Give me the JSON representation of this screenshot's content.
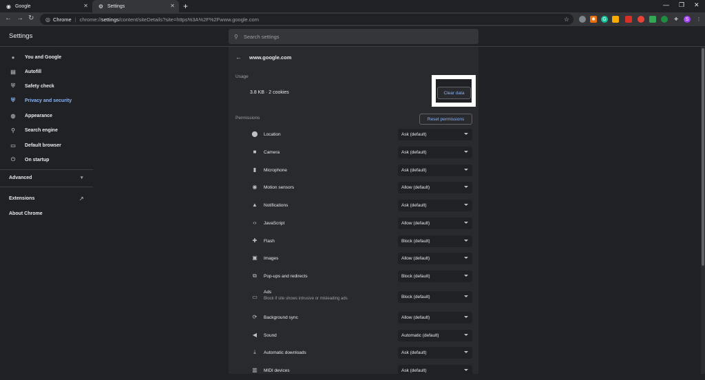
{
  "tabs": [
    {
      "title": "Google",
      "icon": "google-icon"
    },
    {
      "title": "Settings",
      "icon": "gear-icon"
    }
  ],
  "window_controls": [
    "minimize",
    "maximize",
    "close"
  ],
  "toolbar": {
    "chrome_label": "Chrome",
    "url_scheme": "chrome://",
    "url_bold": "settings",
    "url_rest": "/content/siteDetails?site=https%3A%2F%2Fwww.google.com",
    "profile_initial": "S"
  },
  "header": {
    "title": "Settings",
    "search_placeholder": "Search settings"
  },
  "sidebar": {
    "items": [
      {
        "label": "You and Google",
        "icon": "person-icon"
      },
      {
        "label": "Autofill",
        "icon": "clipboard-icon"
      },
      {
        "label": "Safety check",
        "icon": "shield-check-icon"
      },
      {
        "label": "Privacy and security",
        "icon": "shield-icon",
        "active": true
      },
      {
        "label": "Appearance",
        "icon": "palette-icon"
      },
      {
        "label": "Search engine",
        "icon": "search-icon"
      },
      {
        "label": "Default browser",
        "icon": "browser-icon"
      },
      {
        "label": "On startup",
        "icon": "power-icon"
      }
    ],
    "advanced": "Advanced",
    "extensions": "Extensions",
    "about": "About Chrome"
  },
  "site": {
    "title": "www.google.com",
    "usage_label": "Usage",
    "usage_text": "3.8 KB · 2 cookies",
    "clear_data": "Clear data",
    "permissions_label": "Permissions",
    "reset_permissions": "Reset permissions"
  },
  "permissions": [
    {
      "name": "Location",
      "value": "Ask (default)",
      "icon": "location-pin-icon"
    },
    {
      "name": "Camera",
      "value": "Ask (default)",
      "icon": "camera-icon"
    },
    {
      "name": "Microphone",
      "value": "Ask (default)",
      "icon": "microphone-icon"
    },
    {
      "name": "Motion sensors",
      "value": "Allow (default)",
      "icon": "motion-sensor-icon"
    },
    {
      "name": "Notifications",
      "value": "Ask (default)",
      "icon": "bell-icon"
    },
    {
      "name": "JavaScript",
      "value": "Allow (default)",
      "icon": "code-icon"
    },
    {
      "name": "Flash",
      "value": "Block (default)",
      "icon": "puzzle-icon"
    },
    {
      "name": "Images",
      "value": "Allow (default)",
      "icon": "image-icon"
    },
    {
      "name": "Pop-ups and redirects",
      "value": "Block (default)",
      "icon": "popup-icon"
    },
    {
      "name": "Ads",
      "sub": "Block if site shows intrusive or misleading ads",
      "value": "Block (default)",
      "icon": "ads-icon"
    },
    {
      "name": "Background sync",
      "value": "Allow (default)",
      "icon": "sync-icon"
    },
    {
      "name": "Sound",
      "value": "Automatic (default)",
      "icon": "speaker-icon"
    },
    {
      "name": "Automatic downloads",
      "value": "Ask (default)",
      "icon": "download-icon"
    },
    {
      "name": "MIDI devices",
      "value": "Ask (default)",
      "icon": "midi-icon"
    }
  ]
}
